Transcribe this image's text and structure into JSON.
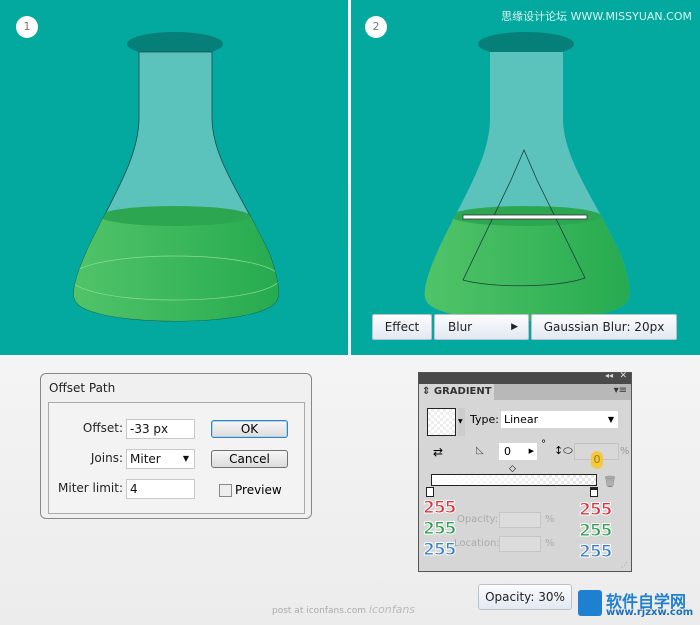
{
  "steps": [
    "1",
    "2"
  ],
  "watermark": "思缘设计论坛 WWW.MISSYUAN.COM",
  "breadcrumb_menu": {
    "effect": "Effect",
    "blur": "Blur",
    "gaussian": "Gaussian Blur: 20px"
  },
  "offset_dialog": {
    "title": "Offset Path",
    "offset_label": "Offset:",
    "offset_value": "-33 px",
    "joins_label": "Joins:",
    "joins_value": "Miter",
    "miter_label": "Miter limit:",
    "miter_value": "4",
    "ok": "OK",
    "cancel": "Cancel",
    "preview": "Preview",
    "preview_checked": false
  },
  "gradient_panel": {
    "title": "GRADIENT",
    "type_label": "Type:",
    "type_value": "Linear",
    "angle": "0",
    "degree": "°",
    "aspect_unit": "%",
    "aspect_badge": "0",
    "opacity_label": "Opacity:",
    "location_label": "Location:",
    "percent": "%",
    "left_stop": {
      "r": "255",
      "g": "255",
      "b": "255"
    },
    "right_stop": {
      "r": "255",
      "g": "255",
      "b": "255"
    }
  },
  "opacity_badge": "Opacity: 30%",
  "footer": {
    "post": "post at iconfans.com",
    "logo": "iconfans",
    "site_logo": "软件自学网",
    "site_url": "www.rjzxw.com"
  },
  "colors": {
    "bg": "#03a89e",
    "liquid": "#3fc45a",
    "red": "#d9323c",
    "green": "#2e9e4e",
    "blue": "#3a7fc4"
  }
}
